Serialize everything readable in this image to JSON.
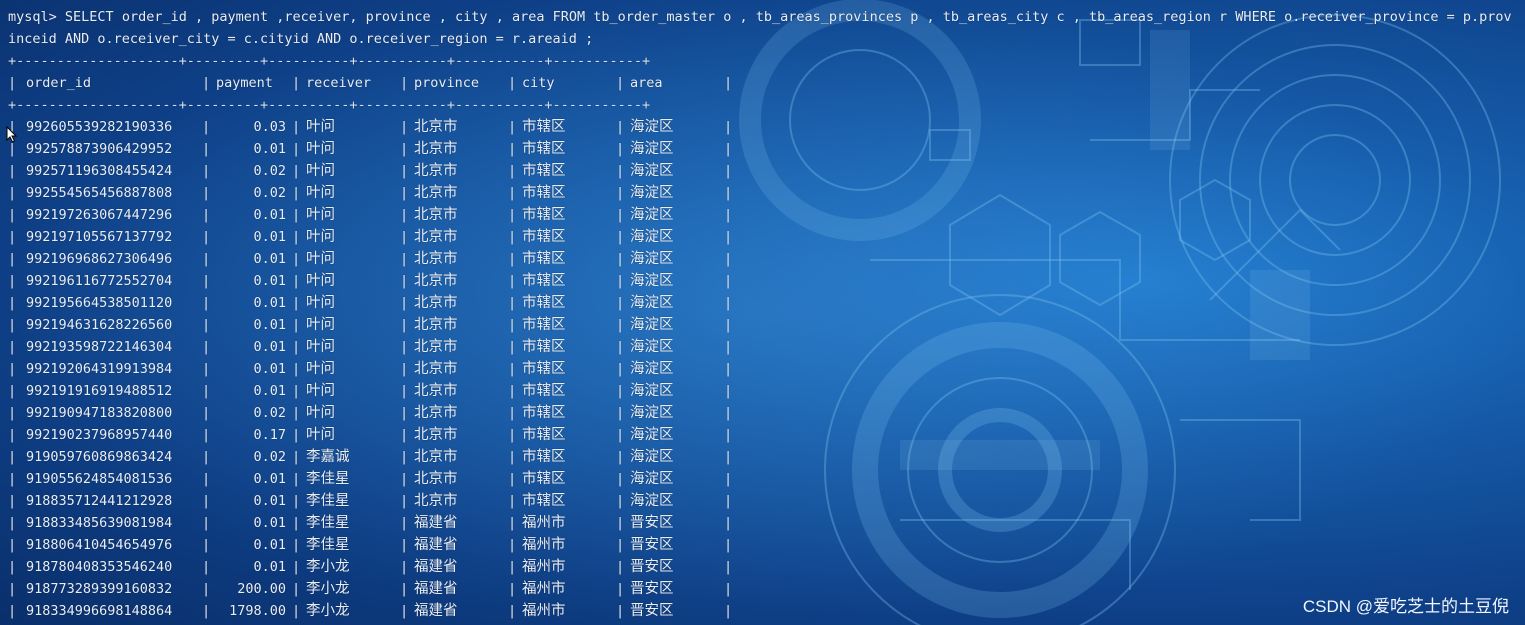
{
  "terminal": {
    "prompt": "mysql>",
    "command": "SELECT order_id , payment ,receiver, province , city , area FROM tb_order_master o , tb_areas_provinces p , tb_areas_city c , tb_areas_region r WHERE o.receiver_province = p.provinceid AND o.receiver_city = c.cityid AND o.receiver_region = r.areaid ;",
    "border": "+--------------------+---------+----------+-----------+-----------+-----------+",
    "columns": [
      "order_id",
      "payment",
      "receiver",
      "province",
      "city",
      "area"
    ],
    "rows": [
      [
        "992605539282190336",
        "0.03",
        "叶问",
        "北京市",
        "市辖区",
        "海淀区"
      ],
      [
        "992578873906429952",
        "0.01",
        "叶问",
        "北京市",
        "市辖区",
        "海淀区"
      ],
      [
        "992571196308455424",
        "0.02",
        "叶问",
        "北京市",
        "市辖区",
        "海淀区"
      ],
      [
        "992554565456887808",
        "0.02",
        "叶问",
        "北京市",
        "市辖区",
        "海淀区"
      ],
      [
        "992197263067447296",
        "0.01",
        "叶问",
        "北京市",
        "市辖区",
        "海淀区"
      ],
      [
        "992197105567137792",
        "0.01",
        "叶问",
        "北京市",
        "市辖区",
        "海淀区"
      ],
      [
        "992196968627306496",
        "0.01",
        "叶问",
        "北京市",
        "市辖区",
        "海淀区"
      ],
      [
        "992196116772552704",
        "0.01",
        "叶问",
        "北京市",
        "市辖区",
        "海淀区"
      ],
      [
        "992195664538501120",
        "0.01",
        "叶问",
        "北京市",
        "市辖区",
        "海淀区"
      ],
      [
        "992194631628226560",
        "0.01",
        "叶问",
        "北京市",
        "市辖区",
        "海淀区"
      ],
      [
        "992193598722146304",
        "0.01",
        "叶问",
        "北京市",
        "市辖区",
        "海淀区"
      ],
      [
        "992192064319913984",
        "0.01",
        "叶问",
        "北京市",
        "市辖区",
        "海淀区"
      ],
      [
        "992191916919488512",
        "0.01",
        "叶问",
        "北京市",
        "市辖区",
        "海淀区"
      ],
      [
        "992190947183820800",
        "0.02",
        "叶问",
        "北京市",
        "市辖区",
        "海淀区"
      ],
      [
        "992190237968957440",
        "0.17",
        "叶问",
        "北京市",
        "市辖区",
        "海淀区"
      ],
      [
        "919059760869863424",
        "0.02",
        "李嘉诚",
        "北京市",
        "市辖区",
        "海淀区"
      ],
      [
        "919055624854081536",
        "0.01",
        "李佳星",
        "北京市",
        "市辖区",
        "海淀区"
      ],
      [
        "918835712441212928",
        "0.01",
        "李佳星",
        "北京市",
        "市辖区",
        "海淀区"
      ],
      [
        "918833485639081984",
        "0.01",
        "李佳星",
        "福建省",
        "福州市",
        "晋安区"
      ],
      [
        "918806410454654976",
        "0.01",
        "李佳星",
        "福建省",
        "福州市",
        "晋安区"
      ],
      [
        "918780408353546240",
        "0.01",
        "李小龙",
        "福建省",
        "福州市",
        "晋安区"
      ],
      [
        "918773289399160832",
        "200.00",
        "李小龙",
        "福建省",
        "福州市",
        "晋安区"
      ],
      [
        "918334996698148864",
        "1798.00",
        "李小龙",
        "福建省",
        "福州市",
        "晋安区"
      ]
    ]
  },
  "watermark": "CSDN @爱吃芝士的土豆倪",
  "colors": {
    "background": "#155aa8",
    "text": "#e8eef8",
    "pattern": "#7fc4f2"
  },
  "icons": {
    "cursor": "mouse-pointer-icon"
  }
}
